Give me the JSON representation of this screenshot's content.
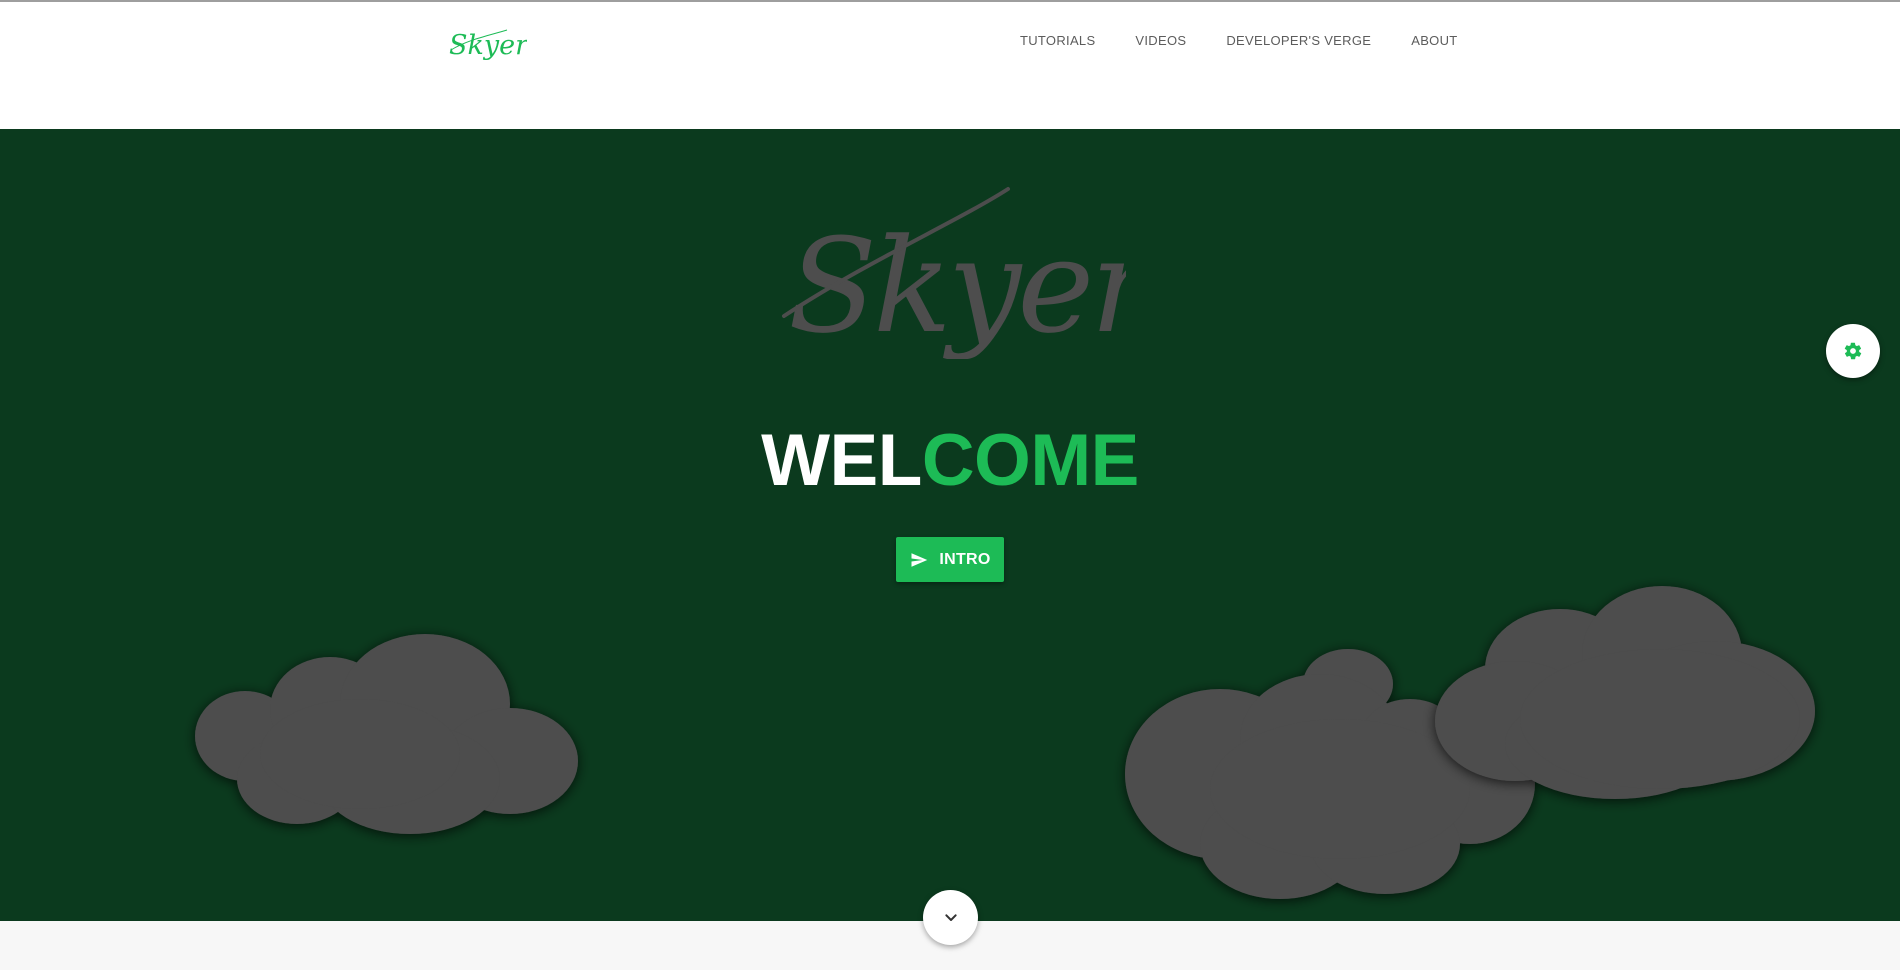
{
  "brand": {
    "logo_text": "Skyer",
    "accent_color": "#1dbb56"
  },
  "nav": {
    "links": [
      {
        "label": "TUTORIALS"
      },
      {
        "label": "VIDEOS"
      },
      {
        "label": "DEVELOPER'S VERGE"
      },
      {
        "label": "ABOUT"
      }
    ]
  },
  "hero": {
    "background_color": "#0b3a1e",
    "logo_text": "Skyer",
    "welcome_part1": "WEL",
    "welcome_part2": "COME",
    "intro_button": {
      "label": "INTRO",
      "icon": "send-icon"
    }
  },
  "fab": {
    "settings_icon": "gear-icon"
  },
  "scroll": {
    "icon": "chevron-down-icon"
  }
}
